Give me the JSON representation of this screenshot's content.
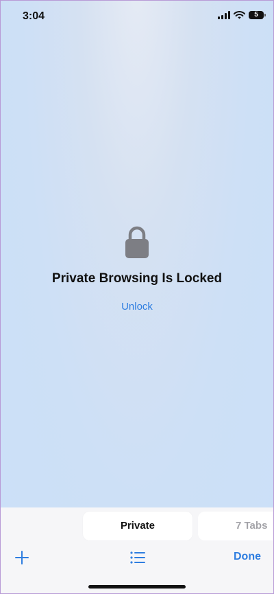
{
  "status_bar": {
    "time": "3:04",
    "battery_level": "5",
    "icons": [
      "signal-icon",
      "wifi-icon",
      "battery-icon"
    ]
  },
  "locked_screen": {
    "icon": "lock-icon",
    "title": "Private Browsing Is Locked",
    "unlock_label": "Unlock"
  },
  "tab_groups": [
    {
      "label": "Private",
      "selected": true
    },
    {
      "label": "7 Tabs",
      "selected": false
    }
  ],
  "toolbar": {
    "add_icon": "plus-icon",
    "list_icon": "list-icon",
    "done_label": "Done"
  },
  "colors": {
    "accent": "#2f7ee0",
    "lock_gray": "#7d7e84",
    "background": "#cbe0f8"
  }
}
